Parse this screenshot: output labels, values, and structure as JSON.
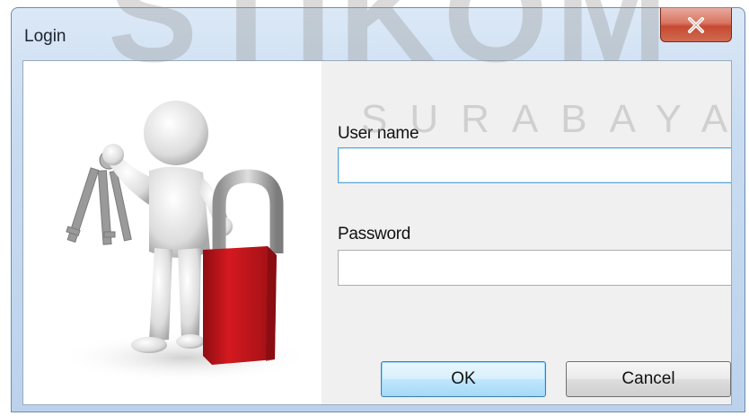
{
  "window": {
    "title": "Login",
    "close_glyph": "X",
    "close_icon": "close-icon"
  },
  "form": {
    "username_label": "User name",
    "username_value": "",
    "password_label": "Password",
    "password_value": ""
  },
  "buttons": {
    "ok_label": "OK",
    "cancel_label": "Cancel"
  },
  "illustration": {
    "icon": "person-with-keys-and-padlock-icon"
  },
  "watermark": {
    "big": "STIKOM",
    "small": "SURABAYA"
  },
  "colors": {
    "padlock_red": "#c8161d",
    "title_bar": "#c9dcf1",
    "close_red": "#c64a31",
    "default_button_border": "#3c7fb1"
  }
}
